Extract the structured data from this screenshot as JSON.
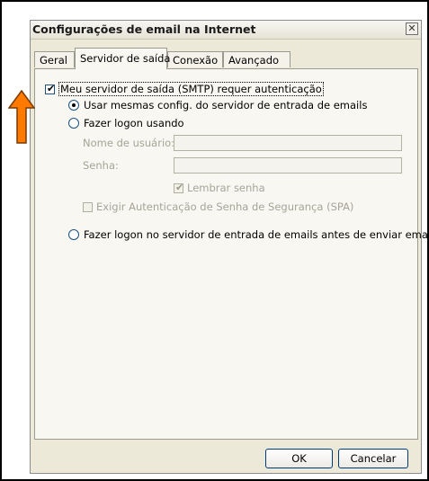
{
  "dialog": {
    "title": "Configurações de email na Internet",
    "close_symbol": "✕"
  },
  "tabs": [
    {
      "label": "Geral",
      "active": false
    },
    {
      "label": "Servidor de saída",
      "active": true
    },
    {
      "label": "Conexão",
      "active": false
    },
    {
      "label": "Avançado",
      "active": false
    }
  ],
  "panel": {
    "smtp_auth_label": "Meu servidor de saída (SMTP) requer autenticação",
    "smtp_auth_checked": true,
    "use_same_label": "Usar mesmas config. do servidor de entrada de emails",
    "logon_using_label": "Fazer logon usando",
    "username_label": "Nome de usuário:",
    "username_value": "",
    "password_label": "Senha:",
    "password_value": "",
    "remember_password_label": "Lembrar senha",
    "remember_password_checked": true,
    "spa_label": "Exigir Autenticação de Senha de Segurança (SPA)",
    "spa_checked": false,
    "logon_before_send_label": "Fazer logon no servidor de entrada de emails antes de enviar email",
    "selected_option": "Usar mesmas config. do servidor de entrada de emails"
  },
  "buttons": {
    "ok": "OK",
    "cancel": "Cancelar"
  },
  "annotation": {
    "arrow_color": "#ff7a00"
  }
}
